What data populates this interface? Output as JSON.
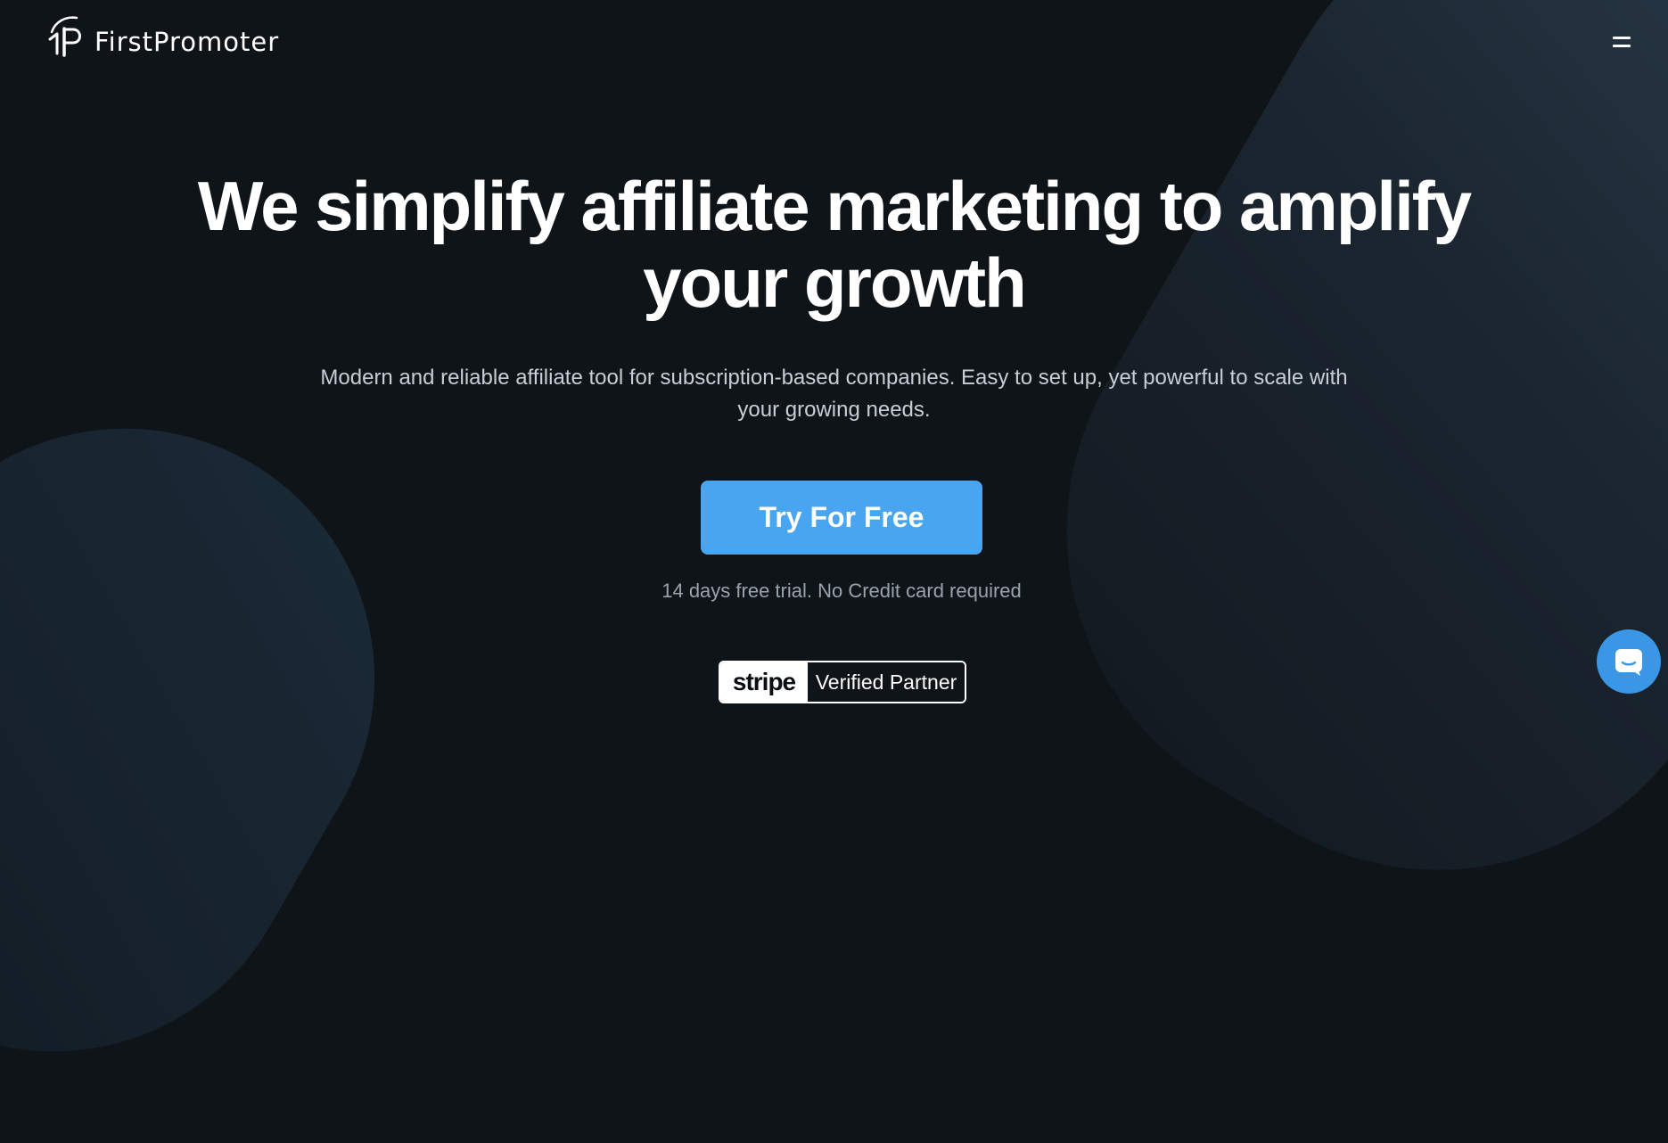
{
  "brand": {
    "name": "FirstPromoter",
    "logo_icon": "firstpromoter-logo-icon"
  },
  "header": {
    "menu_icon": "hamburger-menu-icon"
  },
  "hero": {
    "title": "We simplify affiliate marketing to amplify your growth",
    "subtitle": "Modern and reliable affiliate tool for subscription-based companies. Easy to set up, yet powerful to scale with your growing needs.",
    "cta_label": "Try For Free",
    "trial_note": "14 days free trial. No Credit card required"
  },
  "stripe_badge": {
    "brand": "stripe",
    "label": "Verified Partner"
  },
  "chat": {
    "icon": "chat-icon"
  },
  "colors": {
    "background": "#0f1419",
    "cta": "#4aa5f0",
    "chat": "#3a97e6",
    "subtitle_text": "#c9ced6",
    "note_text": "#9aa3ad"
  }
}
